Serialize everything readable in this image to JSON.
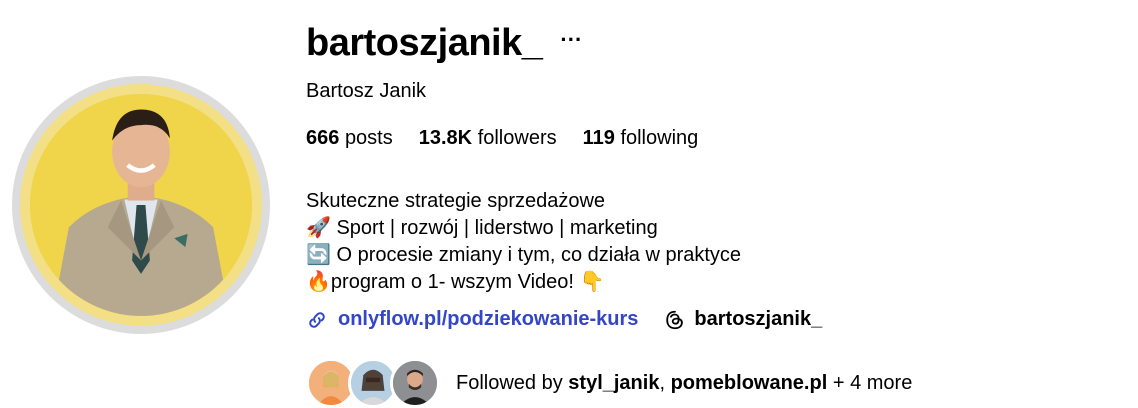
{
  "profile": {
    "username": "bartoszjanik_",
    "more_label": "···",
    "full_name": "Bartosz Janik"
  },
  "stats": {
    "posts_count": "666",
    "posts_label": "posts",
    "followers_count": "13.8K",
    "followers_label": "followers",
    "following_count": "119",
    "following_label": "following"
  },
  "bio": {
    "line1": "Skuteczne strategie sprzedażowe",
    "line2_emoji": "🚀",
    "line2": "Sport | rozwój | liderstwo | marketing",
    "line3_emoji": "🔄",
    "line3": "O procesie zmiany i tym, co działa w praktyce",
    "line4_emoji": "🔥",
    "line4": "program o 1- wszym Video!",
    "line4_end_emoji": "👇"
  },
  "links": {
    "website": "onlyflow.pl/podziekowanie-kurs",
    "threads_handle": "bartoszjanik_"
  },
  "followed_by": {
    "prefix": "Followed by",
    "user1": "styl_janik",
    "separator": ",",
    "user2": "pomeblowane.pl",
    "suffix": "+ 4 more"
  },
  "colors": {
    "link": "#3346c8",
    "avatar_ring": "#dcdcdc",
    "avatar_bg": "#f0d54a"
  }
}
